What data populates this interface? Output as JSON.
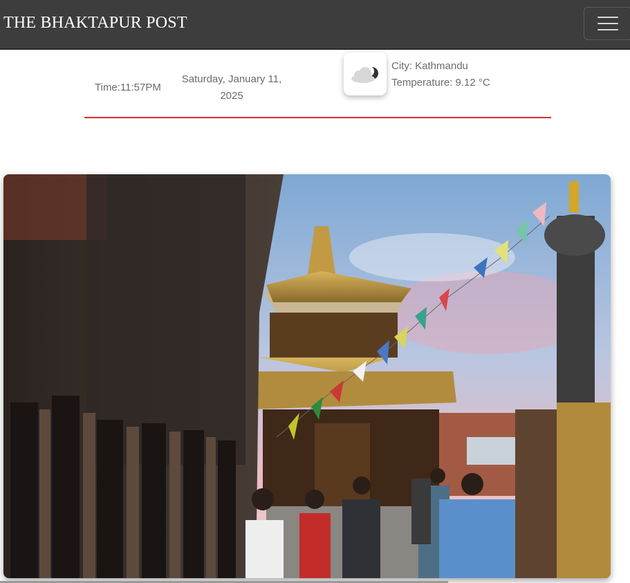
{
  "navbar": {
    "brand": "THE BHAKTAPUR POST",
    "menu_icon": "hamburger-menu-icon"
  },
  "info": {
    "time": "Time:11:57PM",
    "date_line1": "Saturday, January 11,",
    "date_line2": "2025",
    "weather_icon": "partly-cloudy-night-icon",
    "city": "City: Kathmandu",
    "temperature": "Temperature: 9.12 °C"
  },
  "colors": {
    "navbar": "#3d3d3d",
    "divider": "#d0302a",
    "text": "#6b6b6b"
  },
  "hero": {
    "description_icon": "temple-photo"
  }
}
